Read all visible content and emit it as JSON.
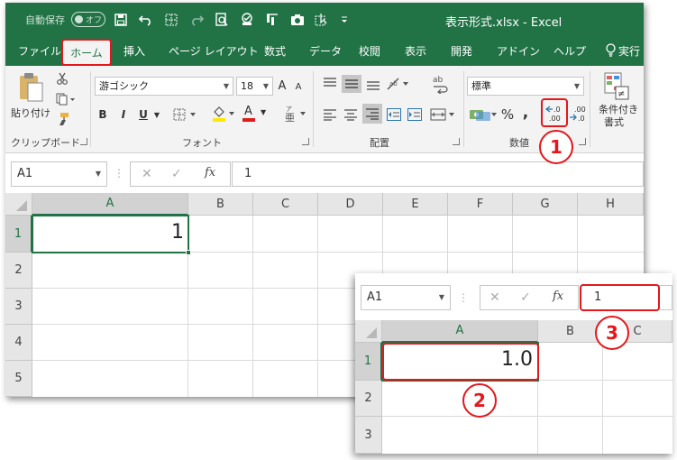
{
  "titlebar": {
    "autosave_label": "自動保存",
    "autosave_state": "オフ",
    "title": "表示形式.xlsx  -  Excel",
    "icons": [
      "save-icon",
      "undo-icon",
      "border-icon",
      "redo-icon",
      "print-preview-icon",
      "touch-mode-icon",
      "format-painter-icon",
      "camera-icon",
      "select-objects-icon",
      "customize-qat-icon"
    ]
  },
  "tabs": [
    "ファイル",
    "ホーム",
    "挿入",
    "ページ レイアウト",
    "数式",
    "データ",
    "校閲",
    "表示",
    "開発",
    "アドイン",
    "ヘルプ",
    "実行"
  ],
  "ribbon": {
    "clipboard": {
      "paste_label": "貼り付け",
      "group_label": "クリップボード"
    },
    "font": {
      "font_name": "游ゴシック",
      "font_size": "18",
      "grow": "A",
      "shrink": "A",
      "bold": "B",
      "italic": "I",
      "underline": "U",
      "font_color": "A",
      "group_label": "フォント"
    },
    "alignment": {
      "group_label": "配置",
      "wrap_label": "ab"
    },
    "number": {
      "format": "標準",
      "percent": "%",
      "comma": ",",
      "increase_decimal": ".0 / .00",
      "decrease_decimal": ".00 / .0",
      "group_label": "数値"
    },
    "styles": {
      "conditional_label_1": "条件付き",
      "conditional_label_2": "書式"
    }
  },
  "formula_bar": {
    "name_box": "A1",
    "fx": "fx",
    "value": "1"
  },
  "sheet": {
    "columns": [
      "A",
      "B",
      "C",
      "D",
      "E",
      "F",
      "G",
      "H"
    ],
    "rows": [
      "1",
      "2",
      "3",
      "4",
      "5"
    ],
    "a1_value": "1"
  },
  "inset": {
    "name_box": "A1",
    "fx": "fx",
    "formula_value": "1",
    "columns": [
      "A",
      "B",
      "C"
    ],
    "rows": [
      "1",
      "2",
      "3"
    ],
    "a1_value": "1.0"
  },
  "callouts": [
    "1",
    "2",
    "3"
  ],
  "colors": {
    "excel_green": "#217346",
    "highlight_red": "#e4171c"
  }
}
